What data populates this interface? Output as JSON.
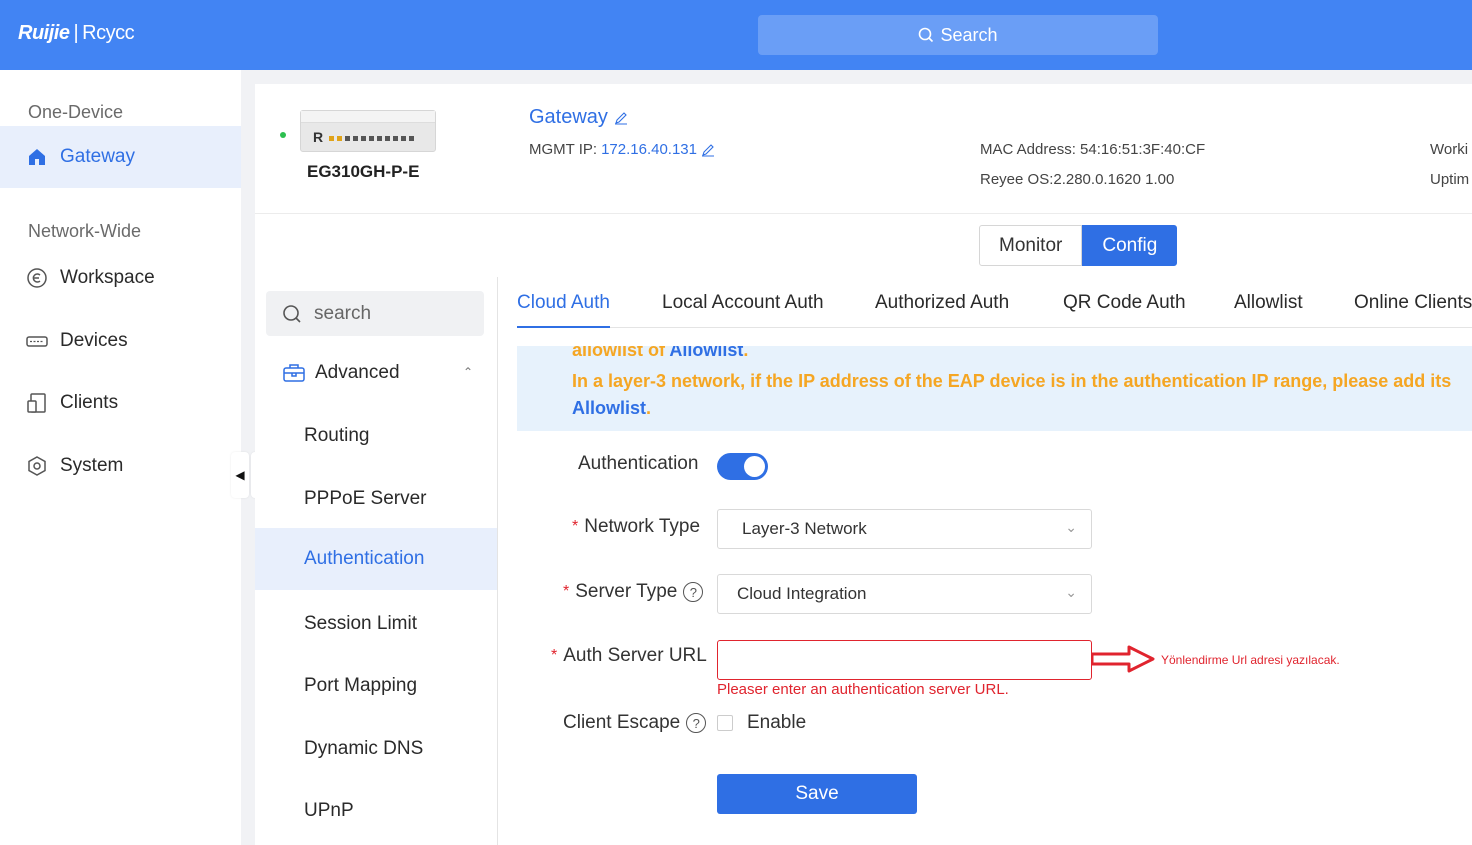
{
  "topbar": {
    "logo_brand": "Ruijie",
    "logo_sep": "|",
    "logo_product": "Rcycc",
    "search_label": "Search"
  },
  "sidebar": {
    "section_one": "One-Device",
    "section_network": "Network-Wide",
    "items": [
      {
        "label": "Gateway",
        "icon": "home-icon",
        "active": true
      },
      {
        "label": "Workspace",
        "icon": "workspace-icon"
      },
      {
        "label": "Devices",
        "icon": "devices-icon"
      },
      {
        "label": "Clients",
        "icon": "clients-icon"
      },
      {
        "label": "System",
        "icon": "system-icon"
      }
    ]
  },
  "device": {
    "model": "EG310GH-P-E",
    "name": "Gateway",
    "mgmt_label": "MGMT IP:",
    "mgmt_ip": "172.16.40.131",
    "mac": "MAC Address: 54:16:51:3F:40:CF",
    "os": "Reyee OS:2.280.0.1620 1.00",
    "work_truncated": "Worki",
    "uptime_truncated": "Uptim"
  },
  "mode": {
    "monitor": "Monitor",
    "config": "Config"
  },
  "subnav": {
    "search_placeholder": "search",
    "group": "Advanced",
    "items": [
      "Routing",
      "PPPoE Server",
      "Authentication",
      "Session Limit",
      "Port Mapping",
      "Dynamic DNS",
      "UPnP"
    ]
  },
  "tabs": [
    "Cloud Auth",
    "Local Account Auth",
    "Authorized Auth",
    "QR Code Auth",
    "Allowlist",
    "Online Clients"
  ],
  "notice": {
    "line1_prefix": "allowlist of ",
    "line1_link": "Allowlist",
    "line1_suffix": ".",
    "line2": "In a layer-3 network, if the IP address of the EAP device is in the authentication IP range, please add its",
    "line3_link": "Allowlist",
    "line3_suffix": "."
  },
  "form": {
    "auth_label": "Authentication",
    "auth_enabled": true,
    "network_type_label": "Network Type",
    "network_type_value": "Layer-3 Network",
    "server_type_label": "Server Type",
    "server_type_value": "Cloud Integration",
    "auth_url_label": "Auth Server URL",
    "auth_url_value": "",
    "auth_url_error": "Pleaser enter an authentication server URL.",
    "escape_label": "Client Escape",
    "escape_option": "Enable",
    "required_mark": "*",
    "save_label": "Save"
  },
  "annotation": "Yönlendirme Url adresi yazılacak.",
  "colors": {
    "primary": "#2f6fe4",
    "topbar": "#4284f3",
    "warning": "#f5a623",
    "error": "#e0242e"
  }
}
